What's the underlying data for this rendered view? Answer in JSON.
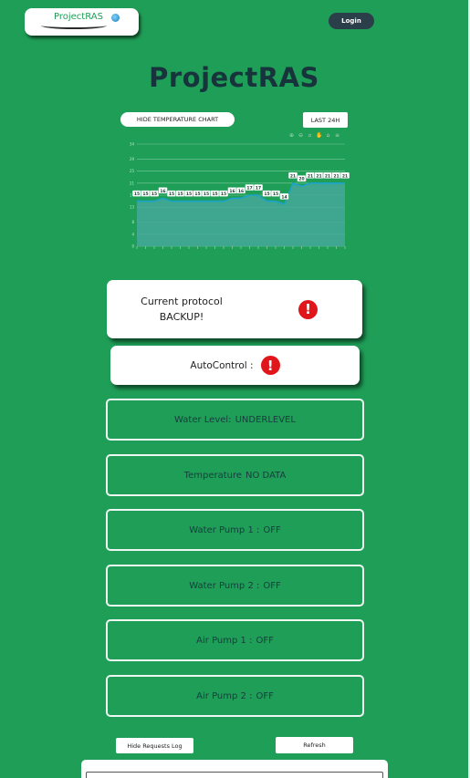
{
  "header": {
    "logo_text": "ProjectRAS",
    "login_label": "Login",
    "title": "ProjectRAS"
  },
  "chart_controls": {
    "hide_label": "HIDE TEMPERATURE CHART",
    "range_label": "LAST 24H"
  },
  "chart_data": {
    "type": "area",
    "title": "",
    "xlabel": "",
    "ylabel": "",
    "ylim": [
      0,
      34
    ],
    "yticks": [
      0,
      4,
      8,
      13,
      17,
      21,
      25,
      29,
      34
    ],
    "grid": true,
    "series": [
      {
        "values": [
          15,
          15,
          15,
          16,
          15,
          15,
          15,
          15,
          15,
          15,
          15,
          16,
          16,
          17,
          17,
          15,
          15,
          14,
          21,
          20,
          21,
          21,
          21,
          21,
          21
        ]
      }
    ],
    "labels": [
      "15",
      "15",
      "15",
      "16",
      "15",
      "15",
      "15",
      "15",
      "15",
      "15",
      "15",
      "16",
      "16",
      "17",
      "17",
      "15",
      "15",
      "14",
      "21",
      "20",
      "21",
      "21",
      "21",
      "21",
      "21"
    ],
    "colors": {
      "line": "#1aa3c8",
      "fill": "#45a89a",
      "grid": "#7fc99c"
    }
  },
  "protocol": {
    "line1": "Current protocol",
    "line2": "BACKUP!",
    "icon": "!"
  },
  "autocontrol": {
    "label": "AutoControl :",
    "icon": "!"
  },
  "status": [
    {
      "label": "Water Level:",
      "value": "UNDERLEVEL"
    },
    {
      "label": "Temperature",
      "value": "NO DATA"
    },
    {
      "label": "Water Pump 1 :",
      "value": "OFF"
    },
    {
      "label": "Water Pump 2 :",
      "value": "OFF"
    },
    {
      "label": "Air Pump 1 :",
      "value": "OFF"
    },
    {
      "label": "Air Pump 2 :",
      "value": "OFF"
    }
  ],
  "log_controls": {
    "hide_label": "Hide Requests Log",
    "refresh_label": "Refresh"
  },
  "colors": {
    "background": "#1f9e57",
    "alert": "#e0161b",
    "login": "#2b3f4a"
  }
}
